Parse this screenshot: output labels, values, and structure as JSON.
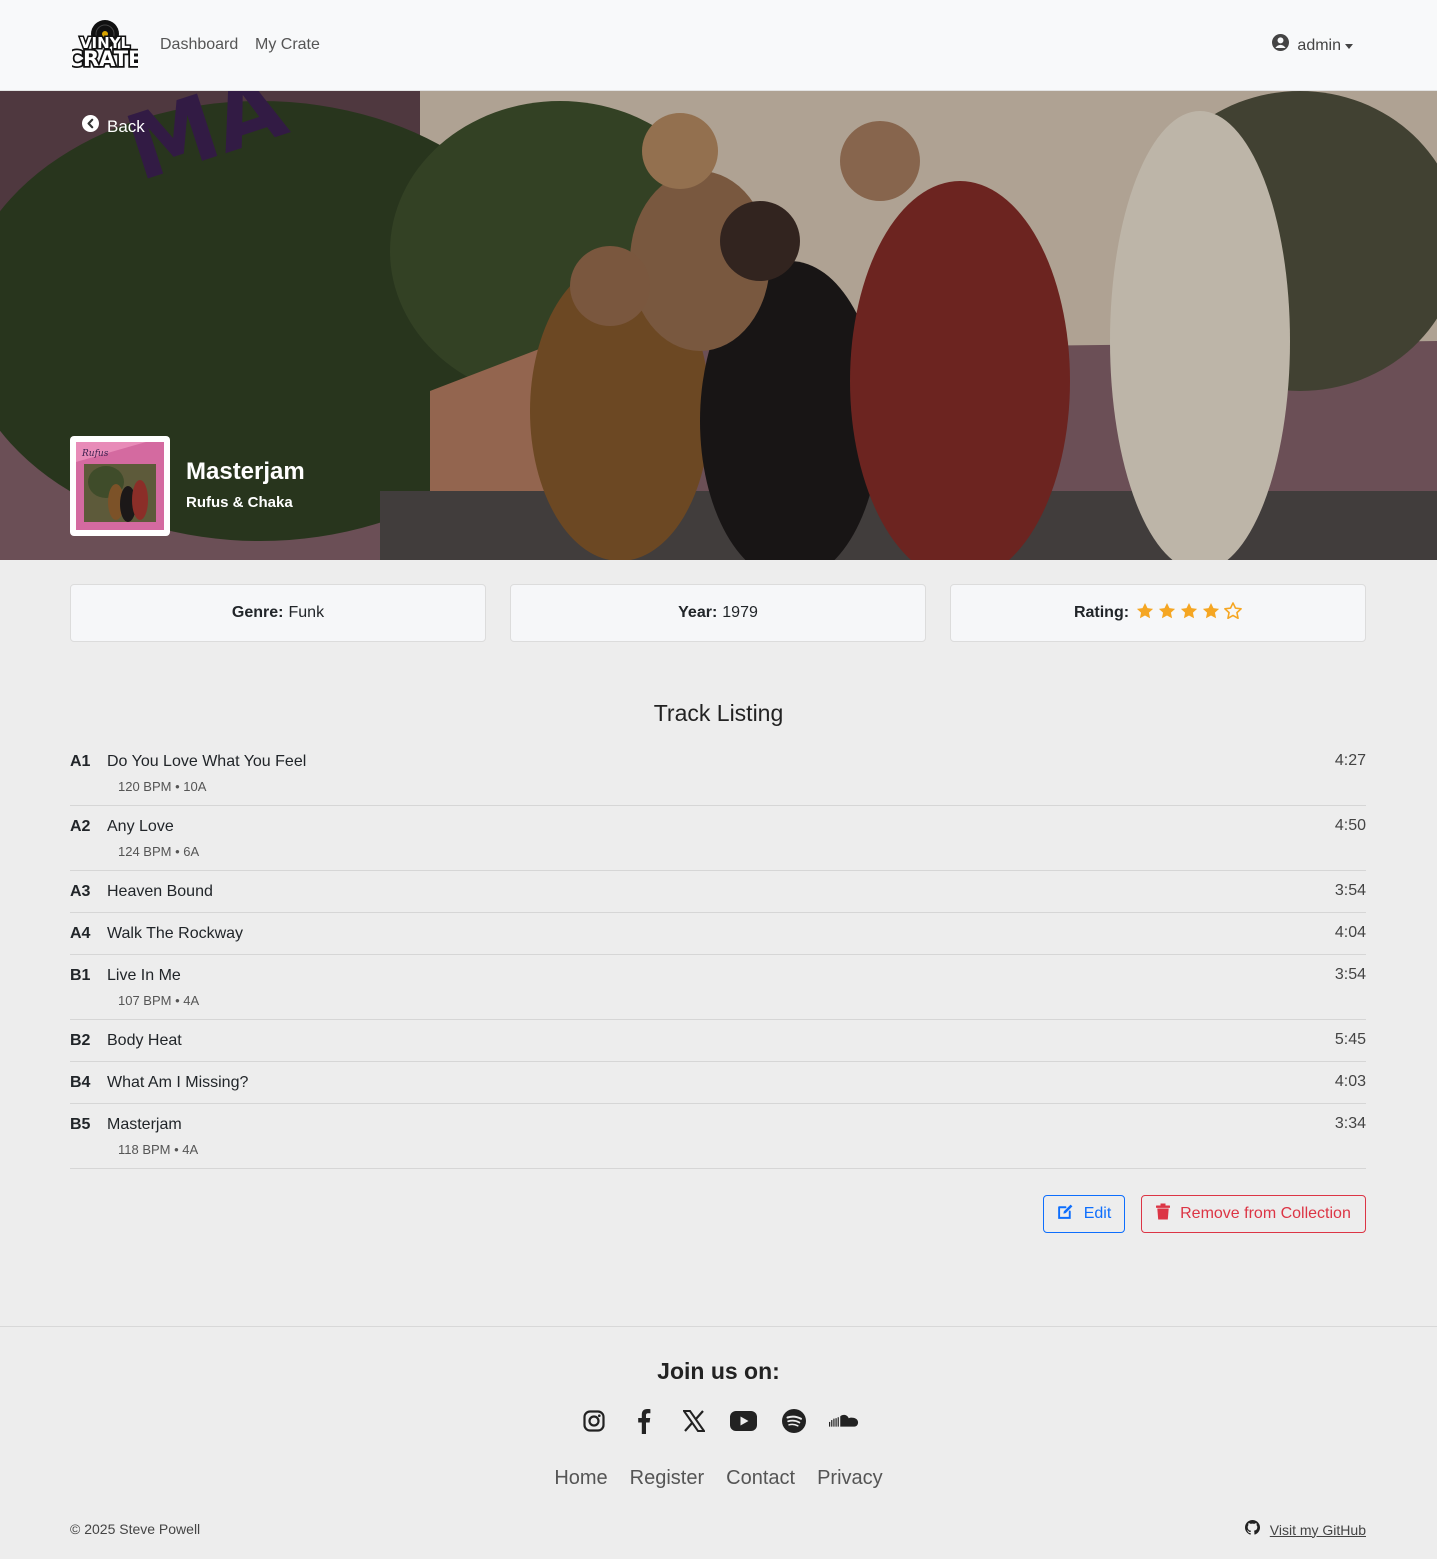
{
  "nav": {
    "logo_line1": "VINYL",
    "logo_line2": "CRATE",
    "links": [
      "Dashboard",
      "My Crate"
    ],
    "user": "admin",
    "user_icon": "user-circle-icon"
  },
  "hero": {
    "back_label": "Back",
    "back_icon": "chevron-left-circle-icon",
    "title": "Masterjam",
    "artist": "Rufus & Chaka"
  },
  "info": {
    "genre_label": "Genre:",
    "genre": "Funk",
    "year_label": "Year:",
    "year": "1979",
    "rating_label": "Rating:",
    "rating": 4,
    "rating_max": 5,
    "star_color": "#f5a623"
  },
  "tracks_title": "Track Listing",
  "tracks": [
    {
      "pos": "A1",
      "title": "Do You Love What You Feel",
      "duration": "4:27",
      "meta": "120 BPM • 10A"
    },
    {
      "pos": "A2",
      "title": "Any Love",
      "duration": "4:50",
      "meta": "124 BPM • 6A"
    },
    {
      "pos": "A3",
      "title": "Heaven Bound",
      "duration": "3:54",
      "meta": ""
    },
    {
      "pos": "A4",
      "title": "Walk The Rockway",
      "duration": "4:04",
      "meta": ""
    },
    {
      "pos": "B1",
      "title": "Live In Me",
      "duration": "3:54",
      "meta": "107 BPM • 4A"
    },
    {
      "pos": "B2",
      "title": "Body Heat",
      "duration": "5:45",
      "meta": ""
    },
    {
      "pos": "B4",
      "title": "What Am I Missing?",
      "duration": "4:03",
      "meta": ""
    },
    {
      "pos": "B5",
      "title": "Masterjam",
      "duration": "3:34",
      "meta": "118 BPM • 4A"
    }
  ],
  "actions": {
    "edit_label": "Edit",
    "remove_label": "Remove from Collection",
    "edit_color": "#0d6efd",
    "remove_color": "#dc3545"
  },
  "footer": {
    "join_label": "Join us on:",
    "socials": [
      "instagram-icon",
      "facebook-icon",
      "x-icon",
      "youtube-icon",
      "spotify-icon",
      "soundcloud-icon"
    ],
    "links": [
      "Home",
      "Register",
      "Contact",
      "Privacy"
    ],
    "copyright": "© 2025 Steve Powell",
    "github_label": "Visit my GitHub"
  }
}
